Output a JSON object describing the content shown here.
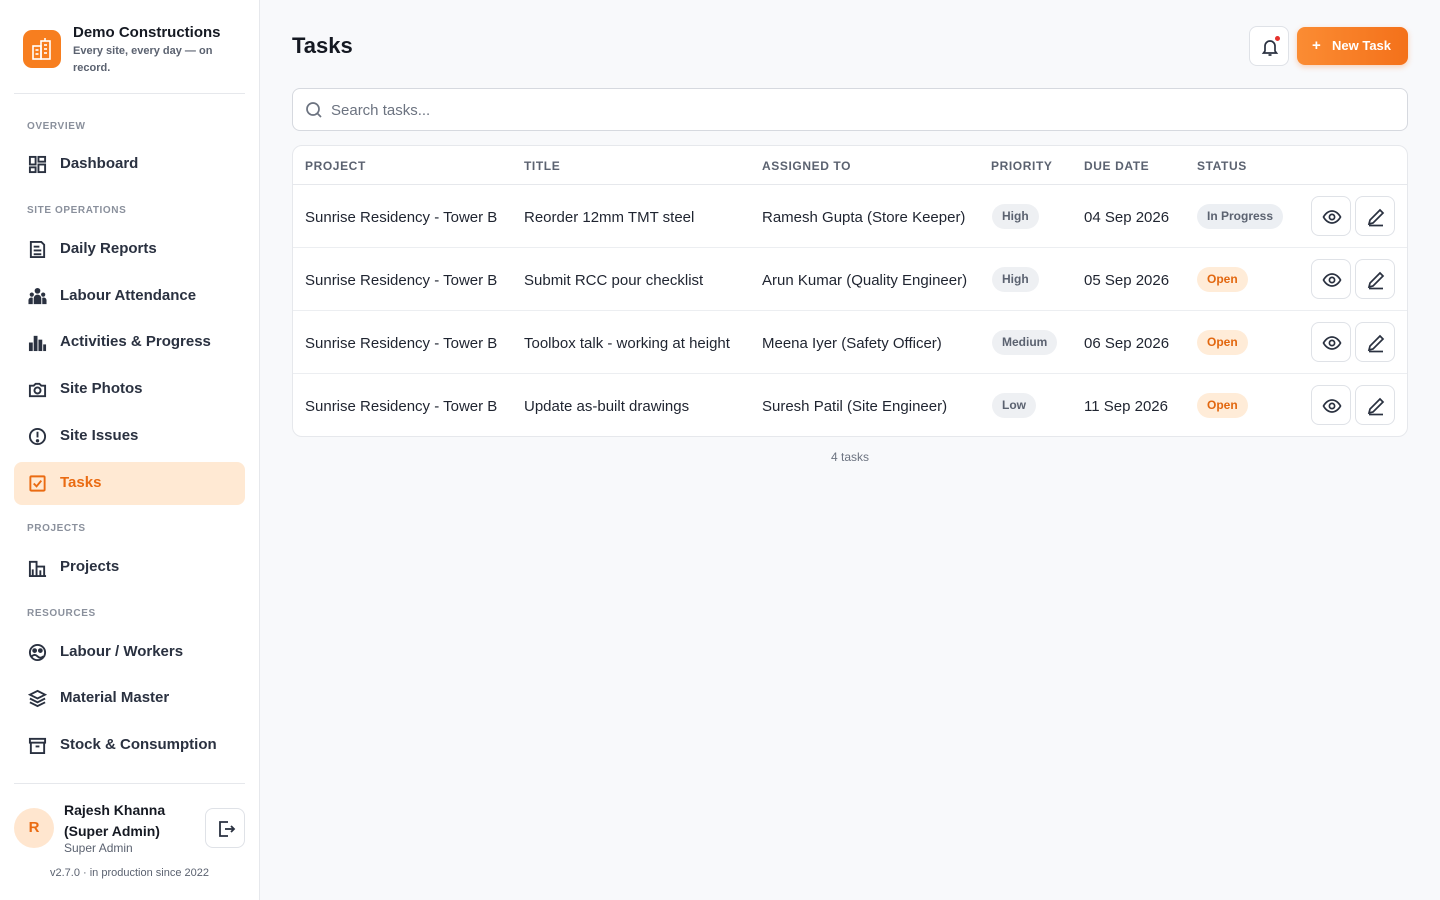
{
  "brand": {
    "name": "Demo Constructions",
    "tagline": "Every site, every day — on record."
  },
  "sidebar": {
    "sections": [
      {
        "label": "OVERVIEW"
      },
      {
        "label": "SITE OPERATIONS"
      },
      {
        "label": "PROJECTS"
      },
      {
        "label": "RESOURCES"
      }
    ],
    "items": [
      {
        "label": "Dashboard",
        "icon": "dashboard-icon"
      },
      {
        "label": "Daily Reports",
        "icon": "report-icon"
      },
      {
        "label": "Labour Attendance",
        "icon": "labour-icon"
      },
      {
        "label": "Activities & Progress",
        "icon": "bar-chart-icon"
      },
      {
        "label": "Site Photos",
        "icon": "camera-icon"
      },
      {
        "label": "Site Issues",
        "icon": "alert-icon"
      },
      {
        "label": "Tasks",
        "icon": "checkbox-icon",
        "active": true
      },
      {
        "label": "Projects",
        "icon": "building-icon"
      },
      {
        "label": "Labour / Workers",
        "icon": "workers-icon"
      },
      {
        "label": "Material Master",
        "icon": "layers-icon"
      },
      {
        "label": "Stock & Consumption",
        "icon": "archive-icon"
      }
    ]
  },
  "user": {
    "initial": "R",
    "name": "Rajesh Khanna (Super Admin)",
    "role": "Super Admin"
  },
  "version": "v2.7.0 · in production since 2022",
  "header": {
    "title": "Tasks",
    "new_task_label": "New Task",
    "plus": "+"
  },
  "search": {
    "placeholder": "Search tasks..."
  },
  "table": {
    "columns": [
      "PROJECT",
      "TITLE",
      "ASSIGNED TO",
      "PRIORITY",
      "DUE DATE",
      "STATUS"
    ],
    "rows": [
      {
        "project": "Sunrise Residency - Tower B",
        "title": "Reorder 12mm TMT steel",
        "assigned": "Ramesh Gupta (Store Keeper)",
        "priority": "High",
        "due": "04 Sep 2026",
        "status": "In Progress"
      },
      {
        "project": "Sunrise Residency - Tower B",
        "title": "Submit RCC pour checklist",
        "assigned": "Arun Kumar (Quality Engineer)",
        "priority": "High",
        "due": "05 Sep 2026",
        "status": "Open"
      },
      {
        "project": "Sunrise Residency - Tower B",
        "title": "Toolbox talk - working at height",
        "assigned": "Meena Iyer (Safety Officer)",
        "priority": "Medium",
        "due": "06 Sep 2026",
        "status": "Open"
      },
      {
        "project": "Sunrise Residency - Tower B",
        "title": "Update as-built drawings",
        "assigned": "Suresh Patil (Site Engineer)",
        "priority": "Low",
        "due": "11 Sep 2026",
        "status": "Open"
      }
    ],
    "count_label": "4 tasks"
  },
  "colors": {
    "accent": "#f4711a",
    "active_bg": "#ffe9d3",
    "open_badge_bg": "#ffecd8"
  }
}
